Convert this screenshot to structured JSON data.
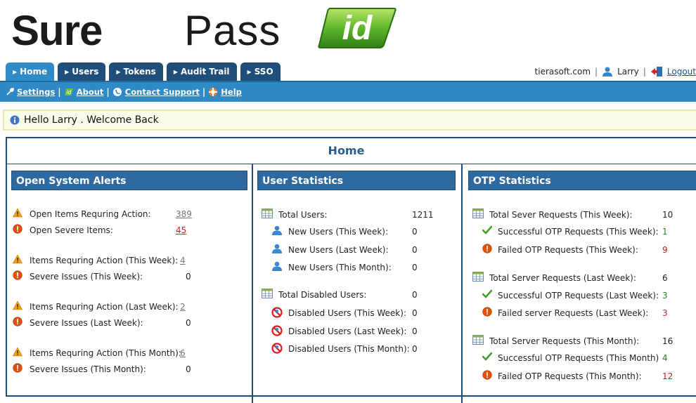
{
  "logo": {
    "part1": "Sure",
    "part2": "Pass",
    "badge": "id"
  },
  "tabs": [
    {
      "label": "Home",
      "active": true
    },
    {
      "label": "Users",
      "active": false
    },
    {
      "label": "Tokens",
      "active": false
    },
    {
      "label": "Audit Trail",
      "active": false
    },
    {
      "label": "SSO",
      "active": false
    }
  ],
  "topright": {
    "domain": "tierasoft.com",
    "user": "Larry",
    "logout": "Logout"
  },
  "toolbar": {
    "settings": "Settings",
    "about": "About",
    "contact": "Contact Support",
    "help": "Help"
  },
  "welcome": "Hello Larry . Welcome Back",
  "main": {
    "title": "Home"
  },
  "alerts": {
    "title": "Open System Alerts",
    "rows": [
      {
        "icon": "warning-icon",
        "label": "Open Items Requring Action:",
        "value": "389"
      },
      {
        "icon": "error-icon",
        "label": "Open Severe Items:",
        "value": "45"
      },
      {
        "icon": "warning-icon",
        "label": "Items Requring Action (This Week):",
        "value": "4"
      },
      {
        "icon": "error-icon",
        "label": "Severe Issues (This Week):",
        "value": "0"
      },
      {
        "icon": "warning-icon",
        "label": "Items Requring Action (Last Week):",
        "value": "2"
      },
      {
        "icon": "error-icon",
        "label": "Severe Issues (Last Week):",
        "value": "0"
      },
      {
        "icon": "warning-icon",
        "label": "Items Requring Action (This Month):",
        "value": "6"
      },
      {
        "icon": "error-icon",
        "label": "Severe Issues (This Month):",
        "value": "0"
      }
    ]
  },
  "users": {
    "title": "User Statistics",
    "rows": [
      {
        "icon": "table-icon",
        "label": "Total Users:",
        "value": "1211"
      },
      {
        "icon": "user-icon",
        "label": "New Users (This Week):",
        "value": "0"
      },
      {
        "icon": "user-icon",
        "label": "New Users (Last Week):",
        "value": "0"
      },
      {
        "icon": "user-icon",
        "label": "New Users (This Month):",
        "value": "0"
      },
      {
        "icon": "table-icon",
        "label": "Total Disabled Users:",
        "value": "0"
      },
      {
        "icon": "disabled-icon",
        "label": "Disabled Users (This Week):",
        "value": "0"
      },
      {
        "icon": "disabled-icon",
        "label": "Disabled Users (Last Week):",
        "value": "0"
      },
      {
        "icon": "disabled-icon",
        "label": "Disabled Users (This Month):",
        "value": "0"
      }
    ]
  },
  "otp": {
    "title": "OTP Statistics",
    "rows": [
      {
        "icon": "table-icon",
        "label": "Total Sever Requests (This Week):",
        "value": "10"
      },
      {
        "icon": "check-icon",
        "label": "Successful OTP Requests (This Week):",
        "value": "1"
      },
      {
        "icon": "error-icon",
        "label": "Failed OTP Requests (This Week):",
        "value": "9"
      },
      {
        "icon": "table-icon",
        "label": "Total Server Requests (Last Week):",
        "value": "6"
      },
      {
        "icon": "check-icon",
        "label": "Successful OTP Requests (Last Week):",
        "value": "3"
      },
      {
        "icon": "error-icon",
        "label": "Failed server Requests (Last Week):",
        "value": "3"
      },
      {
        "icon": "table-icon",
        "label": "Total Server Requests (This Month):",
        "value": "16"
      },
      {
        "icon": "check-icon",
        "label": "Successful OTP Requests (This Month)",
        "value": "4"
      },
      {
        "icon": "error-icon",
        "label": "Failed OTP Requests (This Month):",
        "value": "12"
      }
    ]
  },
  "colors": {
    "tab": "#1f4e7a",
    "tab_active": "#2e8bc8",
    "bar": "#2d8ac7",
    "panel_head": "#2e6aa0",
    "red": "#e0161e",
    "green": "#1d8a1d"
  }
}
